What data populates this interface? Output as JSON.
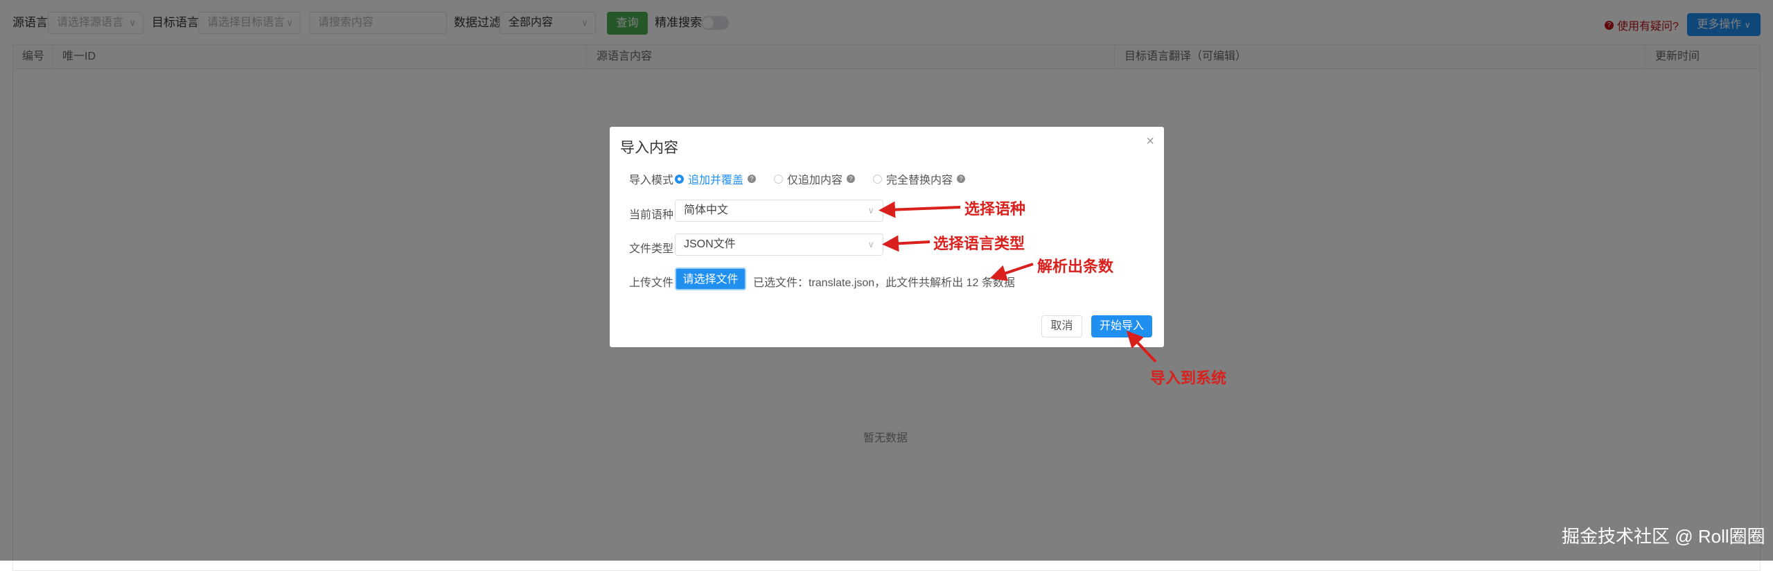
{
  "toolbar": {
    "source_lang_label": "源语言",
    "source_lang_placeholder": "请选择源语言",
    "target_lang_label": "目标语言",
    "target_lang_placeholder": "请选择目标语言",
    "search_placeholder": "请搜索内容",
    "filter_label": "数据过滤",
    "filter_value": "全部内容",
    "query_button": "查询",
    "exact_search_label": "精准搜索",
    "exact_search_on": false,
    "help_link": "使用有疑问?",
    "more_actions": "更多操作"
  },
  "table": {
    "columns": [
      "编号",
      "唯一ID",
      "源语言内容",
      "目标语言翻译（可编辑）",
      "更新时间"
    ],
    "empty_text": "暂无数据"
  },
  "modal": {
    "title": "导入内容",
    "mode_label": "导入模式",
    "modes": [
      "追加并覆盖",
      "仅追加内容",
      "完全替换内容"
    ],
    "selected_mode": 0,
    "language_label": "当前语种",
    "language_value": "简体中文",
    "file_type_label": "文件类型",
    "file_type_value": "JSON文件",
    "upload_label": "上传文件",
    "choose_file_button": "请选择文件",
    "file_info": "已选文件：translate.json，此文件共解析出 12 条数据",
    "cancel_button": "取消",
    "start_button": "开始导入"
  },
  "annotations": {
    "language": "选择语种",
    "file_type": "选择语言类型",
    "count": "解析出条数",
    "import": "导入到系统"
  },
  "watermark": "掘金技术社区 @ Roll圈圈",
  "colors": {
    "primary": "#1f8ff0",
    "success": "#4caf50",
    "danger": "#d9201c"
  }
}
